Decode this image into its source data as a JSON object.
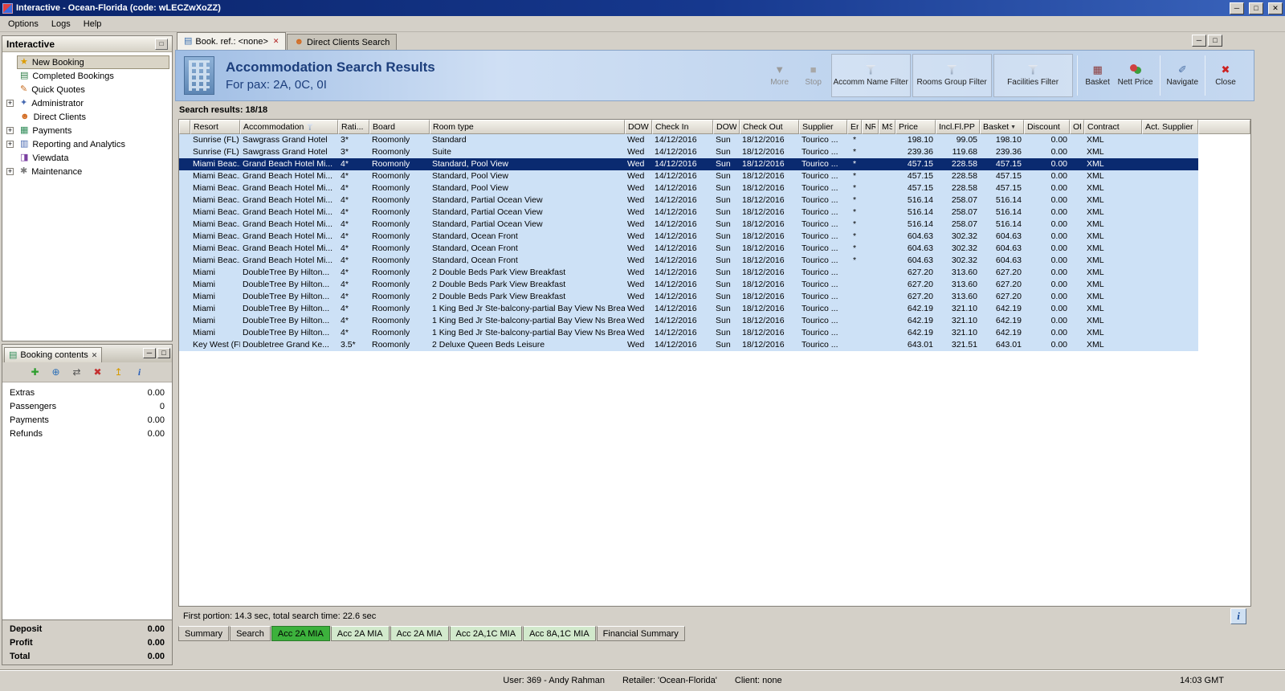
{
  "window": {
    "title": "Interactive - Ocean-Florida (code: wLECZwXoZZ)",
    "menu": [
      "Options",
      "Logs",
      "Help"
    ]
  },
  "sidebar": {
    "title": "Interactive",
    "items": [
      {
        "label": "New Booking",
        "icon": "new-booking",
        "expandable": false,
        "selected": true
      },
      {
        "label": "Completed Bookings",
        "icon": "completed-bookings",
        "expandable": false
      },
      {
        "label": "Quick Quotes",
        "icon": "quick-quotes",
        "expandable": false
      },
      {
        "label": "Administrator",
        "icon": "administrator",
        "expandable": true
      },
      {
        "label": "Direct Clients",
        "icon": "direct-clients",
        "expandable": false
      },
      {
        "label": "Payments",
        "icon": "payments",
        "expandable": true
      },
      {
        "label": "Reporting and Analytics",
        "icon": "reporting",
        "expandable": true
      },
      {
        "label": "Viewdata",
        "icon": "viewdata",
        "expandable": false
      },
      {
        "label": "Maintenance",
        "icon": "maintenance",
        "expandable": true
      }
    ]
  },
  "booking_contents": {
    "title": "Booking contents",
    "toolbar_icons": [
      "add",
      "web",
      "transfer",
      "delete",
      "export",
      "info"
    ],
    "rows": [
      {
        "label": "Extras",
        "value": "0.00"
      },
      {
        "label": "Passengers",
        "value": "0"
      },
      {
        "label": "Payments",
        "value": "0.00"
      },
      {
        "label": "Refunds",
        "value": "0.00"
      }
    ],
    "totals": [
      {
        "label": "Deposit",
        "value": "0.00"
      },
      {
        "label": "Profit",
        "value": "0.00"
      },
      {
        "label": "Total",
        "value": "0.00"
      }
    ]
  },
  "main": {
    "tabs": [
      {
        "label": "Book. ref.: <none>",
        "icon": "booking-tab",
        "closable": true,
        "active": true
      },
      {
        "label": "Direct Clients Search",
        "icon": "clients-tab",
        "closable": false,
        "active": false
      }
    ],
    "header": {
      "title": "Accommodation Search Results",
      "subtitle": "For pax: 2A, 0C, 0I"
    },
    "toolbar": [
      {
        "label": "More",
        "icon": "more",
        "disabled": true
      },
      {
        "label": "Stop",
        "icon": "stop",
        "disabled": true
      },
      {
        "label": "Accomm Name Filter",
        "icon": "funnel",
        "boxed": true
      },
      {
        "label": "Rooms Group Filter",
        "icon": "funnel",
        "boxed": true
      },
      {
        "label": "Facilities Filter",
        "icon": "funnel",
        "boxed": true
      },
      {
        "label": "Basket",
        "icon": "basket",
        "sep_before": true
      },
      {
        "label": "Nett Price",
        "icon": "coins"
      },
      {
        "label": "Navigate",
        "icon": "navigate",
        "sep_before": true
      },
      {
        "label": "Close",
        "icon": "close",
        "sep_before": true
      }
    ],
    "results_label": "Search results: 18/18",
    "status_line": "First portion: 14.3 sec, total search time: 22.6 sec",
    "bottom_tabs": [
      {
        "label": "Summary",
        "state": "normal"
      },
      {
        "label": "Search",
        "state": "normal"
      },
      {
        "label": "Acc 2A MIA",
        "state": "active"
      },
      {
        "label": "Acc 2A MIA",
        "state": "acc"
      },
      {
        "label": "Acc 2A MIA",
        "state": "acc"
      },
      {
        "label": "Acc 2A,1C MIA",
        "state": "acc"
      },
      {
        "label": "Acc 8A,1C MIA",
        "state": "acc"
      },
      {
        "label": "Financial Summary",
        "state": "normal"
      }
    ]
  },
  "table": {
    "columns": [
      "Resort",
      "Accommodation",
      "Rati...",
      "Board",
      "Room type",
      "DOW",
      "Check In",
      "DOW",
      "Check Out",
      "Supplier",
      "Er",
      "NR",
      "MS",
      "Price",
      "Incl.Fl.PP",
      "Basket",
      "Discount",
      "Of",
      "Contract",
      "Act. Supplier"
    ],
    "selected_row": 2,
    "rows": [
      [
        "Sunrise (FL)",
        "Sawgrass Grand Hotel",
        "3*",
        "Roomonly",
        "Standard",
        "Wed",
        "14/12/2016",
        "Sun",
        "18/12/2016",
        "Tourico ...",
        "*",
        "",
        "",
        "198.10",
        "99.05",
        "198.10",
        "0.00",
        "",
        "XML",
        ""
      ],
      [
        "Sunrise (FL)",
        "Sawgrass Grand Hotel",
        "3*",
        "Roomonly",
        "Suite",
        "Wed",
        "14/12/2016",
        "Sun",
        "18/12/2016",
        "Tourico ...",
        "*",
        "",
        "",
        "239.36",
        "119.68",
        "239.36",
        "0.00",
        "",
        "XML",
        ""
      ],
      [
        "Miami Beac...",
        "Grand Beach Hotel Mi...",
        "4*",
        "Roomonly",
        "Standard, Pool View",
        "Wed",
        "14/12/2016",
        "Sun",
        "18/12/2016",
        "Tourico ...",
        "*",
        "",
        "",
        "457.15",
        "228.58",
        "457.15",
        "0.00",
        "",
        "XML",
        ""
      ],
      [
        "Miami Beac...",
        "Grand Beach Hotel Mi...",
        "4*",
        "Roomonly",
        "Standard, Pool View",
        "Wed",
        "14/12/2016",
        "Sun",
        "18/12/2016",
        "Tourico ...",
        "*",
        "",
        "",
        "457.15",
        "228.58",
        "457.15",
        "0.00",
        "",
        "XML",
        ""
      ],
      [
        "Miami Beac...",
        "Grand Beach Hotel Mi...",
        "4*",
        "Roomonly",
        "Standard, Pool View",
        "Wed",
        "14/12/2016",
        "Sun",
        "18/12/2016",
        "Tourico ...",
        "*",
        "",
        "",
        "457.15",
        "228.58",
        "457.15",
        "0.00",
        "",
        "XML",
        ""
      ],
      [
        "Miami Beac...",
        "Grand Beach Hotel Mi...",
        "4*",
        "Roomonly",
        "Standard, Partial Ocean View",
        "Wed",
        "14/12/2016",
        "Sun",
        "18/12/2016",
        "Tourico ...",
        "*",
        "",
        "",
        "516.14",
        "258.07",
        "516.14",
        "0.00",
        "",
        "XML",
        ""
      ],
      [
        "Miami Beac...",
        "Grand Beach Hotel Mi...",
        "4*",
        "Roomonly",
        "Standard, Partial Ocean View",
        "Wed",
        "14/12/2016",
        "Sun",
        "18/12/2016",
        "Tourico ...",
        "*",
        "",
        "",
        "516.14",
        "258.07",
        "516.14",
        "0.00",
        "",
        "XML",
        ""
      ],
      [
        "Miami Beac...",
        "Grand Beach Hotel Mi...",
        "4*",
        "Roomonly",
        "Standard, Partial Ocean View",
        "Wed",
        "14/12/2016",
        "Sun",
        "18/12/2016",
        "Tourico ...",
        "*",
        "",
        "",
        "516.14",
        "258.07",
        "516.14",
        "0.00",
        "",
        "XML",
        ""
      ],
      [
        "Miami Beac...",
        "Grand Beach Hotel Mi...",
        "4*",
        "Roomonly",
        "Standard, Ocean Front",
        "Wed",
        "14/12/2016",
        "Sun",
        "18/12/2016",
        "Tourico ...",
        "*",
        "",
        "",
        "604.63",
        "302.32",
        "604.63",
        "0.00",
        "",
        "XML",
        ""
      ],
      [
        "Miami Beac...",
        "Grand Beach Hotel Mi...",
        "4*",
        "Roomonly",
        "Standard, Ocean Front",
        "Wed",
        "14/12/2016",
        "Sun",
        "18/12/2016",
        "Tourico ...",
        "*",
        "",
        "",
        "604.63",
        "302.32",
        "604.63",
        "0.00",
        "",
        "XML",
        ""
      ],
      [
        "Miami Beac...",
        "Grand Beach Hotel Mi...",
        "4*",
        "Roomonly",
        "Standard, Ocean Front",
        "Wed",
        "14/12/2016",
        "Sun",
        "18/12/2016",
        "Tourico ...",
        "*",
        "",
        "",
        "604.63",
        "302.32",
        "604.63",
        "0.00",
        "",
        "XML",
        ""
      ],
      [
        "Miami",
        "DoubleTree By Hilton...",
        "4*",
        "Roomonly",
        "2 Double Beds Park View Breakfast",
        "Wed",
        "14/12/2016",
        "Sun",
        "18/12/2016",
        "Tourico ...",
        "",
        "",
        "",
        "627.20",
        "313.60",
        "627.20",
        "0.00",
        "",
        "XML",
        ""
      ],
      [
        "Miami",
        "DoubleTree By Hilton...",
        "4*",
        "Roomonly",
        "2 Double Beds Park View Breakfast",
        "Wed",
        "14/12/2016",
        "Sun",
        "18/12/2016",
        "Tourico ...",
        "",
        "",
        "",
        "627.20",
        "313.60",
        "627.20",
        "0.00",
        "",
        "XML",
        ""
      ],
      [
        "Miami",
        "DoubleTree By Hilton...",
        "4*",
        "Roomonly",
        "2 Double Beds Park View Breakfast",
        "Wed",
        "14/12/2016",
        "Sun",
        "18/12/2016",
        "Tourico ...",
        "",
        "",
        "",
        "627.20",
        "313.60",
        "627.20",
        "0.00",
        "",
        "XML",
        ""
      ],
      [
        "Miami",
        "DoubleTree By Hilton...",
        "4*",
        "Roomonly",
        "1 King Bed Jr Ste-balcony-partial Bay View Ns Brea",
        "Wed",
        "14/12/2016",
        "Sun",
        "18/12/2016",
        "Tourico ...",
        "",
        "",
        "",
        "642.19",
        "321.10",
        "642.19",
        "0.00",
        "",
        "XML",
        ""
      ],
      [
        "Miami",
        "DoubleTree By Hilton...",
        "4*",
        "Roomonly",
        "1 King Bed Jr Ste-balcony-partial Bay View Ns Brea",
        "Wed",
        "14/12/2016",
        "Sun",
        "18/12/2016",
        "Tourico ...",
        "",
        "",
        "",
        "642.19",
        "321.10",
        "642.19",
        "0.00",
        "",
        "XML",
        ""
      ],
      [
        "Miami",
        "DoubleTree By Hilton...",
        "4*",
        "Roomonly",
        "1 King Bed Jr Ste-balcony-partial Bay View Ns Brea",
        "Wed",
        "14/12/2016",
        "Sun",
        "18/12/2016",
        "Tourico ...",
        "",
        "",
        "",
        "642.19",
        "321.10",
        "642.19",
        "0.00",
        "",
        "XML",
        ""
      ],
      [
        "Key West (FL)",
        "Doubletree Grand Ke...",
        "3.5*",
        "Roomonly",
        "2 Deluxe Queen Beds Leisure",
        "Wed",
        "14/12/2016",
        "Sun",
        "18/12/2016",
        "Tourico ...",
        "",
        "",
        "",
        "643.01",
        "321.51",
        "643.01",
        "0.00",
        "",
        "XML",
        ""
      ]
    ]
  },
  "statusbar": {
    "user": "User: 369 - Andy Rahman",
    "retailer": "Retailer: 'Ocean-Florida'",
    "client": "Client: none",
    "time": "14:03 GMT"
  }
}
